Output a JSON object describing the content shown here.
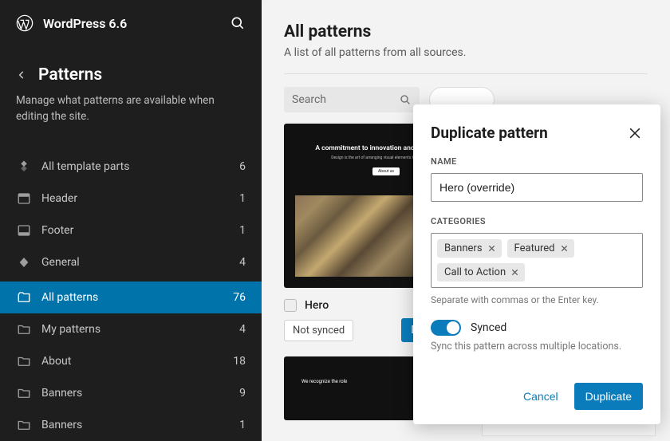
{
  "header": {
    "app_title": "WordPress 6.6"
  },
  "sidebar": {
    "section_title": "Patterns",
    "description": "Manage what patterns are available when editing the site.",
    "groups": {
      "template_parts": [
        {
          "label": "All template parts",
          "count": "6",
          "icon": "diamond-stack-icon"
        },
        {
          "label": "Header",
          "count": "1",
          "icon": "header-icon"
        },
        {
          "label": "Footer",
          "count": "1",
          "icon": "footer-icon"
        },
        {
          "label": "General",
          "count": "4",
          "icon": "diamond-icon"
        }
      ],
      "pattern_folders": [
        {
          "label": "All patterns",
          "count": "76",
          "icon": "folder-open-icon",
          "active": true
        },
        {
          "label": "My patterns",
          "count": "4",
          "icon": "folder-icon"
        },
        {
          "label": "About",
          "count": "18",
          "icon": "folder-icon"
        },
        {
          "label": "Banners",
          "count": "9",
          "icon": "folder-icon"
        },
        {
          "label": "Banners",
          "count": "1",
          "icon": "folder-icon"
        }
      ]
    }
  },
  "main": {
    "title": "All patterns",
    "subtitle": "A list of all patterns from all sources.",
    "search_placeholder": "Search",
    "card": {
      "title": "Hero",
      "sync_label": "Not synced",
      "dup_tooltip": "Duplicate",
      "preview_heading": "A commitment to innovation and sustainability",
      "preview_sub": "Design is the art of arranging visual elements to communicate",
      "preview_cta": "About us"
    }
  },
  "modal": {
    "title": "Duplicate pattern",
    "name_field": {
      "label": "NAME",
      "value": "Hero (override)"
    },
    "categories_field": {
      "label": "CATEGORIES",
      "tags": [
        "Banners",
        "Featured",
        "Call to Action"
      ],
      "hint": "Separate with commas or the Enter key."
    },
    "synced": {
      "label": "Synced",
      "description": "Sync this pattern across multiple locations.",
      "on": true
    },
    "actions": {
      "cancel": "Cancel",
      "confirm": "Duplicate"
    }
  },
  "colors": {
    "accent": "#0a7cbb"
  }
}
